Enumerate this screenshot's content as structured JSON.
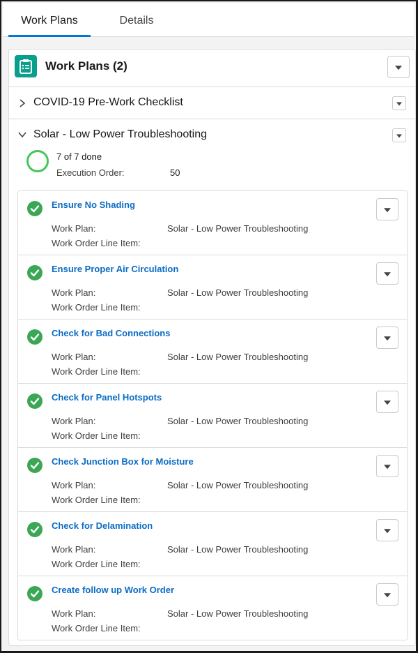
{
  "tabs": [
    {
      "label": "Work Plans",
      "active": true
    },
    {
      "label": "Details",
      "active": false
    }
  ],
  "card": {
    "title": "Work Plans (2)",
    "icon": "work-plan-icon"
  },
  "sections": [
    {
      "label": "COVID-19 Pre-Work Checklist",
      "expanded": false
    },
    {
      "label": "Solar - Low Power Troubleshooting",
      "expanded": true
    }
  ],
  "plan": {
    "progress_text": "7 of 7 done",
    "completed": 7,
    "total": 7,
    "execution_order_label": "Execution Order:",
    "execution_order_value": "50"
  },
  "field_labels": {
    "work_plan": "Work Plan:",
    "work_order_line_item": "Work Order Line Item:"
  },
  "steps": [
    {
      "title": "Ensure No Shading",
      "work_plan": "Solar - Low Power Troubleshooting",
      "work_order_line_item": ""
    },
    {
      "title": "Ensure Proper Air Circulation",
      "work_plan": "Solar - Low Power Troubleshooting",
      "work_order_line_item": ""
    },
    {
      "title": "Check for Bad Connections",
      "work_plan": "Solar - Low Power Troubleshooting",
      "work_order_line_item": ""
    },
    {
      "title": "Check for Panel Hotspots",
      "work_plan": "Solar - Low Power Troubleshooting",
      "work_order_line_item": ""
    },
    {
      "title": "Check Junction Box for Moisture",
      "work_plan": "Solar - Low Power Troubleshooting",
      "work_order_line_item": ""
    },
    {
      "title": "Check for Delamination",
      "work_plan": "Solar - Low Power Troubleshooting",
      "work_order_line_item": ""
    },
    {
      "title": "Create follow up Work Order",
      "work_plan": "Solar - Low Power Troubleshooting",
      "work_order_line_item": ""
    }
  ],
  "colors": {
    "accent": "#0176d3",
    "link": "#0b6cc4",
    "success": "#3ba755",
    "icon_bg": "#0a9f8d"
  }
}
